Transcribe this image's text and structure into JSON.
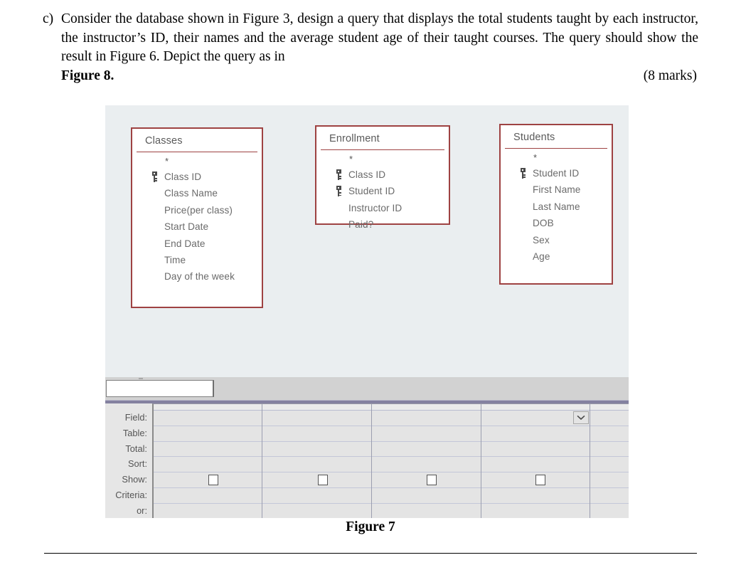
{
  "question": {
    "marker": "c)",
    "text": "Consider the database shown in Figure 3, design a query that displays the total students taught by each instructor, the instructor’s ID, their names and the average student age of their taught courses. The query should show the result in Figure 6. Depict the query as in",
    "figure_ref": "Figure 8.",
    "marks": "(8 marks)"
  },
  "figure": {
    "caption": "Figure 7"
  },
  "access": {
    "search_value": "",
    "search_placeholder": "",
    "tables": [
      {
        "name": "Classes",
        "fields": [
          {
            "label": "*",
            "key": false,
            "star": true
          },
          {
            "label": "Class ID",
            "key": true,
            "star": false
          },
          {
            "label": "Class Name",
            "key": false,
            "star": false
          },
          {
            "label": "Price(per class)",
            "key": false,
            "star": false
          },
          {
            "label": "Start Date",
            "key": false,
            "star": false
          },
          {
            "label": "End Date",
            "key": false,
            "star": false
          },
          {
            "label": "Time",
            "key": false,
            "star": false
          },
          {
            "label": "Day of the week",
            "key": false,
            "star": false
          }
        ]
      },
      {
        "name": "Enrollment",
        "fields": [
          {
            "label": "*",
            "key": false,
            "star": true
          },
          {
            "label": "Class ID",
            "key": true,
            "star": false
          },
          {
            "label": "Student ID",
            "key": true,
            "star": false
          },
          {
            "label": "Instructor ID",
            "key": false,
            "star": false
          },
          {
            "label": "Paid?",
            "key": false,
            "star": false
          }
        ]
      },
      {
        "name": "Students",
        "fields": [
          {
            "label": "*",
            "key": false,
            "star": true
          },
          {
            "label": "Student ID",
            "key": true,
            "star": false
          },
          {
            "label": "First Name",
            "key": false,
            "star": false
          },
          {
            "label": "Last Name",
            "key": false,
            "star": false
          },
          {
            "label": "DOB",
            "key": false,
            "star": false
          },
          {
            "label": "Sex",
            "key": false,
            "star": false
          },
          {
            "label": "Age",
            "key": false,
            "star": false
          }
        ]
      }
    ],
    "grid": {
      "row_labels": [
        "Field:",
        "Table:",
        "Total:",
        "Sort:",
        "Show:",
        "Criteria:",
        "or:"
      ],
      "columns": [
        {
          "field": "",
          "table": "",
          "total": "",
          "sort": "",
          "show": false,
          "criteria": "",
          "or": ""
        },
        {
          "field": "",
          "table": "",
          "total": "",
          "sort": "",
          "show": false,
          "criteria": "",
          "or": ""
        },
        {
          "field": "",
          "table": "",
          "total": "",
          "sort": "",
          "show": false,
          "criteria": "",
          "or": ""
        },
        {
          "field": "",
          "table": "",
          "total": "",
          "sort": "",
          "show": false,
          "criteria": "",
          "or": ""
        },
        {
          "field": "",
          "table": "",
          "total": "",
          "sort": "",
          "show": null,
          "criteria": "",
          "or": ""
        }
      ],
      "dropdown_icon": "chevron-down-icon"
    }
  },
  "colors": {
    "table_border": "#9e4242",
    "pane_background": "#eaeef0",
    "grid_background": "#e4e4e4",
    "splitter": "#d2d2d2",
    "splitter_edge": "#8481a0",
    "field_text": "#6a6a6a",
    "title_text": "#5a5a5a"
  }
}
